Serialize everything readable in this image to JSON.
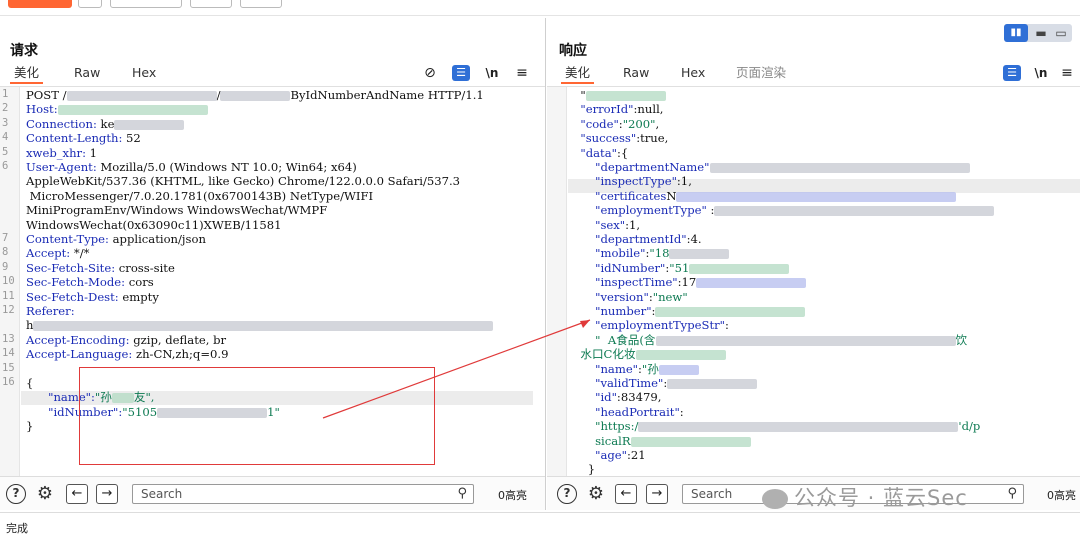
{
  "request": {
    "title": "请求",
    "tabs": [
      "美化",
      "Raw",
      "Hex"
    ],
    "tools": {
      "hide": "⊘",
      "newline": "\\n",
      "menu": "≡"
    },
    "lines": [
      {
        "n": "1",
        "t": "POST /",
        "blur": 150,
        "t2": "/",
        "blur2": 70,
        "t3": "ByIdNumberAndName HTTP/1.1"
      },
      {
        "n": "2",
        "k": "Host:",
        "blur": 150
      },
      {
        "n": "3",
        "k": "Connection:",
        "v": " ke",
        "blur": 70
      },
      {
        "n": "4",
        "k": "Content-Length:",
        "v": " 52"
      },
      {
        "n": "5",
        "k": "xweb_xhr:",
        "v": " 1"
      },
      {
        "n": "6",
        "k": "User-Agent:",
        "v": " Mozilla/5.0 (Windows NT 10.0; Win64; x64)"
      },
      {
        "n": "",
        "v": "AppleWebKit/537.36 (KHTML, like Gecko) Chrome/122.0.0.0 Safari/537.3"
      },
      {
        "n": "",
        "v": " MicroMessenger/7.0.20.1781(0x6700143B) NetType/WIFI"
      },
      {
        "n": "",
        "v": "MiniProgramEnv/Windows WindowsWechat/WMPF"
      },
      {
        "n": "",
        "v": "WindowsWechat(0x63090c11)XWEB/11581"
      },
      {
        "n": "7",
        "k": "Content-Type:",
        "v": " application/json"
      },
      {
        "n": "8",
        "k": "Accept:",
        "v": " */*"
      },
      {
        "n": "9",
        "k": "Sec-Fetch-Site:",
        "v": " cross-site"
      },
      {
        "n": "10",
        "k": "Sec-Fetch-Mode:",
        "v": " cors"
      },
      {
        "n": "11",
        "k": "Sec-Fetch-Dest:",
        "v": " empty"
      },
      {
        "n": "12",
        "k": "Referer:"
      },
      {
        "n": "",
        "v": "h",
        "blur": 460
      },
      {
        "n": "13",
        "k": "Accept-Encoding:",
        "v": " gzip, deflate, br"
      },
      {
        "n": "14",
        "k": "Accept-Language:",
        "v": " zh-CN,zh;q=0.9"
      },
      {
        "n": "15",
        "v": ""
      },
      {
        "n": "16",
        "v": "{"
      },
      {
        "n": "",
        "k": "      \"name\":",
        "s": "\"孙",
        "blur": 22,
        "s2": "友\","
      },
      {
        "n": "",
        "k": "      \"idNumber\":",
        "s": "\"5105",
        "blur": 110,
        "s2": "1\""
      },
      {
        "n": "",
        "v": "}"
      }
    ],
    "search_placeholder": "Search",
    "matches": "0高亮"
  },
  "response": {
    "title": "响应",
    "tabs": [
      "美化",
      "Raw",
      "Hex",
      "页面渲染"
    ],
    "tools": {
      "newline": "\\n",
      "menu": "≡"
    },
    "lines": [
      {
        "v": "  \"",
        "blur": 80
      },
      {
        "k": "  \"errorId\"",
        "v": ":null,"
      },
      {
        "k": "  \"code\"",
        "v": ":",
        "s": "\"200\"",
        "v2": ","
      },
      {
        "k": "  \"success\"",
        "v": ":true,"
      },
      {
        "k": "  \"data\"",
        "v": ":{"
      },
      {
        "k": "      \"departmentName\"",
        "blur": 260
      },
      {
        "k": "      \"inspectType\"",
        "v": ":1,"
      },
      {
        "k": "      \"certificates",
        "v": "N",
        "blur": 280
      },
      {
        "k": "      \"employmentType\"",
        "v": " :",
        "blur": 280
      },
      {
        "k": "      \"sex\"",
        "v": ":1,"
      },
      {
        "k": "      \"departmentId\"",
        "v": ":4.",
        "blur": 0
      },
      {
        "k": "      \"mobile\"",
        "v": ":",
        "s": "\"18",
        "blur": 60
      },
      {
        "k": "      \"idNumber\"",
        "v": ":",
        "s": "\"51",
        "blur": 100
      },
      {
        "k": "      \"inspectTime\"",
        "v": ":17",
        "blur": 110
      },
      {
        "k": "      \"version\"",
        "v": ":",
        "s": "\"new\""
      },
      {
        "k": "      \"number\"",
        "v": ":",
        "blur": 150
      },
      {
        "k": "      \"employmentTypeStr\"",
        "v": ":"
      },
      {
        "s": "      \"  A食品(含",
        "blur": 300,
        "s2": "饮"
      },
      {
        "s": "  水口C化妆",
        "blur": 90
      },
      {
        "k": "      \"name\"",
        "v": ":",
        "s": "\"孙",
        "blur": 40
      },
      {
        "k": "      \"validTime\"",
        "v": ":",
        "blur": 90
      },
      {
        "k": "      \"id\"",
        "v": ":83479,"
      },
      {
        "k": "      \"headPortrait\"",
        "v": ":"
      },
      {
        "s": "      \"https:/",
        "blur": 320,
        "s2": "'d/p"
      },
      {
        "s": "      sicalR",
        "blur": 120
      },
      {
        "k": "      \"age\"",
        "v": ":21"
      },
      {
        "v": "    }"
      },
      {
        "v": "}"
      }
    ],
    "search_placeholder": "Search",
    "matches": "0高亮"
  },
  "status": "完成",
  "watermark": "公众号 · 蓝云Sec",
  "colors": {
    "accent": "#ff6633",
    "blue": "#2f6fd6",
    "key": "#1a2bb5",
    "string": "#0d7a52",
    "annotation": "#e03a3a"
  }
}
